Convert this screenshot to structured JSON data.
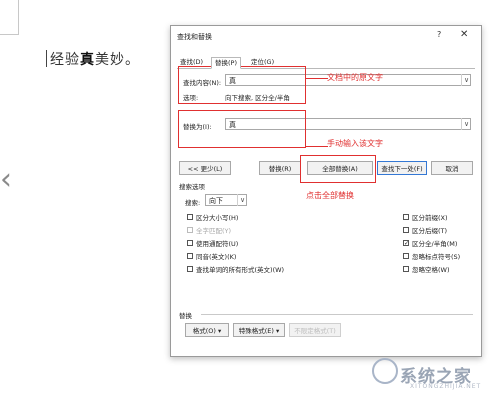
{
  "document": {
    "text_before": "经验",
    "text_bold": "真",
    "text_after": "美妙。"
  },
  "dialog": {
    "title": "查找和替换",
    "help": "?",
    "close": "✕",
    "tabs": [
      "查找(D)",
      "替换(P)",
      "定位(G)"
    ],
    "find": {
      "label": "查找内容(N):",
      "value": "真",
      "options_label": "选项:",
      "options_value": "向下搜索, 区分全/半角"
    },
    "replace": {
      "label": "替换为(I):",
      "value": "真"
    },
    "buttons": {
      "less": "<< 更少(L)",
      "replace": "替换(R)",
      "replace_all": "全部替换(A)",
      "find_next": "查找下一处(F)",
      "cancel": "取消"
    },
    "search_options": {
      "heading": "搜索选项",
      "search_label": "搜索:",
      "search_value": "向下",
      "left": [
        {
          "label": "区分大小写(H)",
          "checked": false,
          "disabled": false
        },
        {
          "label": "全字匹配(Y)",
          "checked": false,
          "disabled": true
        },
        {
          "label": "使用通配符(U)",
          "checked": false,
          "disabled": false
        },
        {
          "label": "同音(英文)(K)",
          "checked": false,
          "disabled": false
        },
        {
          "label": "查找单词的所有形式(英文)(W)",
          "checked": false,
          "disabled": false
        }
      ],
      "right": [
        {
          "label": "区分前缀(X)",
          "checked": false
        },
        {
          "label": "区分后缀(T)",
          "checked": false
        },
        {
          "label": "区分全/半角(M)",
          "checked": true
        },
        {
          "label": "忽略标点符号(S)",
          "checked": false
        },
        {
          "label": "忽略空格(W)",
          "checked": false
        }
      ]
    },
    "replace_section": {
      "heading": "替换",
      "format": "格式(O) ▾",
      "special": "特殊格式(E) ▾",
      "no_format": "不限定格式(T)"
    }
  },
  "annotations": {
    "original_text": "文档中的原文字",
    "manual_input": "手动输入该文字",
    "click_replace_all": "点击全部替换",
    "color": "#e03030"
  },
  "watermark": {
    "text": "系统之家",
    "sub": "XITONGZHIJIA.NET"
  }
}
